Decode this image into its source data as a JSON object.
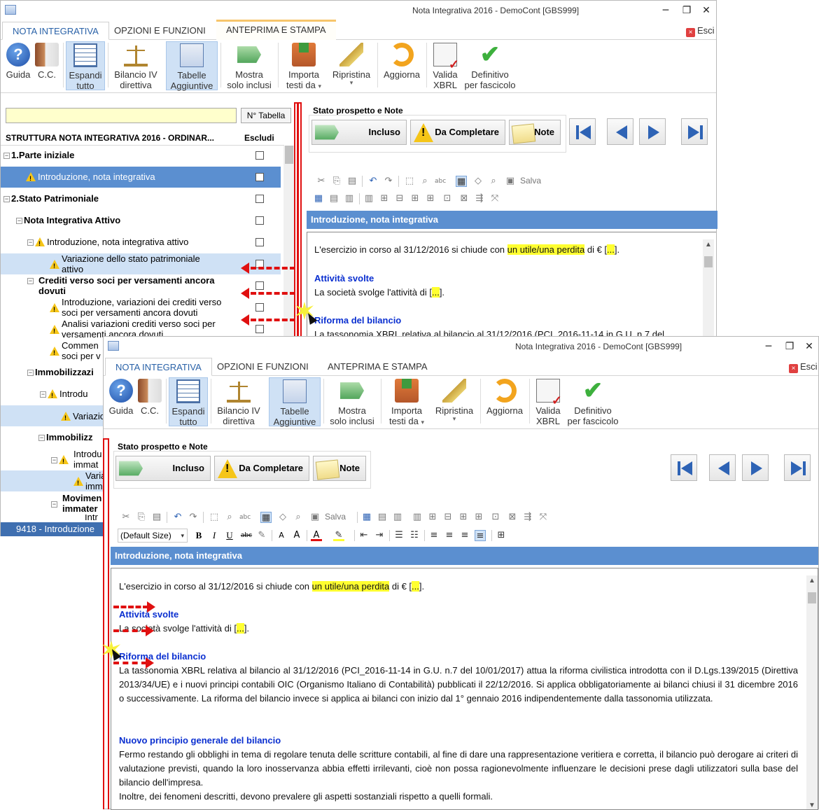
{
  "window": {
    "title": "Nota Integrativa 2016 - DemoCont [GBS999]",
    "min": "─",
    "max": "❐",
    "close": "✕"
  },
  "tabs": [
    "NOTA INTEGRATIVA",
    "OPZIONI E FUNZIONI",
    "ANTEPRIMA E STAMPA"
  ],
  "exit_label": "Esci",
  "exit_mark": "×",
  "ribbon": {
    "guida": "Guida",
    "cc": "C.C.",
    "espandi_1": "Espandi",
    "espandi_2": "tutto",
    "bilancio_1": "Bilancio IV",
    "bilancio_2": "direttiva",
    "tabelle_1": "Tabelle",
    "tabelle_2": "Aggiuntive",
    "mostra_1": "Mostra",
    "mostra_2": "solo inclusi",
    "importa_1": "Importa",
    "importa_2": "testi da",
    "ripristina": "Ripristina",
    "aggiorna": "Aggiorna",
    "valida_1": "Valida",
    "valida_2": "XBRL",
    "definitivo_1": "Definitivo",
    "definitivo_2": "per fascicolo",
    "dropdown_mark": "▾",
    "help_mark": "?"
  },
  "left": {
    "search_value": "",
    "n_tabella": "N° Tabella",
    "tree_header": "STRUTTURA NOTA INTEGRATIVA 2016 - ORDINAR...",
    "escludi": "Escludi",
    "tree": [
      "1.Parte iniziale",
      "Introduzione, nota integrativa",
      "2.Stato Patrimoniale",
      "Nota Integrativa Attivo",
      "Introduzione, nota integrativa attivo",
      "Variazione dello stato patrimoniale",
      "attivo",
      "Crediti verso soci per versamenti ancora",
      "dovuti",
      "Introduzione, variazioni dei crediti verso",
      "soci per versamenti ancora dovuti",
      "Analisi variazioni crediti verso soci per",
      "versamenti ancora dovuti",
      "Commen",
      "soci per v",
      "Immobilizzazi",
      "Introdu",
      "Variazio",
      "Immobilizz",
      "Introdu",
      "immat",
      "Varia",
      "imm",
      "Movimen",
      "immater",
      "Intr"
    ],
    "status": "9418 - Introduzione"
  },
  "stato": {
    "title": "Stato prospetto e Note",
    "incluso": "Incluso",
    "da_completare": "Da Completare",
    "note": "Note"
  },
  "toolbar": {
    "salva": "Salva",
    "default_size": "(Default Size)",
    "cut": "✂",
    "copy": "⎘",
    "paste": "📋",
    "undo": "↶",
    "redo": "↷",
    "find": "⌕",
    "bold": "B",
    "italic": "I",
    "underline": "U",
    "strike": "abc"
  },
  "section_title": "Introduzione, nota integrativa",
  "doc": {
    "p1_pre": "L'esercizio in corso al 31/12/2016 si chiude con ",
    "p1_hl": "un utile/una perdita",
    "p1_mid": " di € [",
    "p1_dots": "...",
    "p1_end": "].",
    "h_attivita": "Attività svolte",
    "p2_pre": "La società svolge l'attività di [",
    "p2_dots": "...",
    "p2_end": "].",
    "h_riforma": "Riforma del bilancio",
    "p3": "La tassonomia XBRL relativa al bilancio al 31/12/2016 (PCI_2016-11-14 in G.U. n.7 del 10/01/2017) attua la riforma civilistica introdotta con il D.Lgs.139/2015 (Direttiva 2013/34/UE) e i nuovi principi contabili OIC (Organismo Italiano di Contabilità) pubblicati il 22/12/2016. Si applica obbligatoriamente ai bilanci chiusi il 31 dicembre 2016 o successivamente. La riforma del bilancio invece si applica ai bilanci con inizio dal 1° gennaio 2016 indipendentemente dalla tassonomia utilizzata.",
    "p3_short": "La tassonomia XBRL relativa al bilancio al 31/12/2016 (PCI_2016-11-14 in G.U. n.7 del",
    "h_nuovo": "Nuovo principio generale del bilancio",
    "p4": "Fermo restando gli obblighi in tema di regolare tenuta delle scritture contabili, al fine di dare una rappresentazione veritiera e corretta, il bilancio può derogare ai criteri di valutazione previsti, quando la loro inosservanza abbia effetti irrilevanti, cioè non possa ragionevolmente influenzare le decisioni prese dagli utilizzatori sulla base del bilancio dell'impresa.",
    "p5": "Inoltre, dei fenomeni descritti, devono prevalere gli aspetti sostanziali rispetto a quelli formali."
  },
  "colors": {
    "accent": "#5b8fd0",
    "highlight": "#ffff30",
    "heading": "#0a2fd0",
    "annotation": "#e01010"
  }
}
